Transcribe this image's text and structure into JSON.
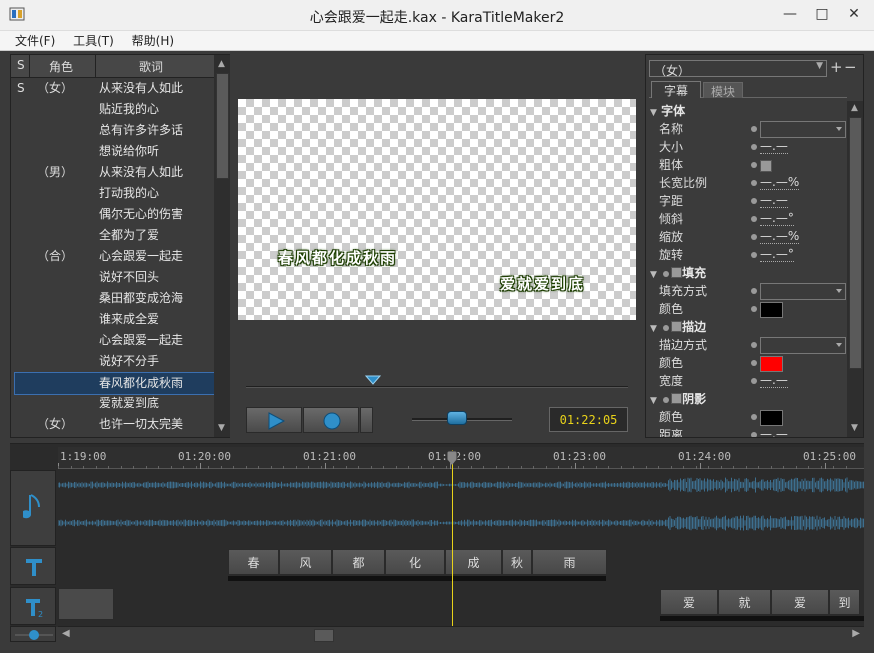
{
  "window": {
    "title": "心会跟爱一起走.kax - KaraTitleMaker2",
    "minimize": "—",
    "maximize": "□",
    "close": "✕"
  },
  "menu": [
    {
      "label": "文件(F)"
    },
    {
      "label": "工具(T)"
    },
    {
      "label": "帮助(H)"
    }
  ],
  "lyrics": {
    "headers": {
      "s": "S",
      "role": "角色",
      "text": "歌词"
    },
    "rows": [
      {
        "s": "S",
        "role": "（女）",
        "text": "从来没有人如此"
      },
      {
        "s": "",
        "role": "",
        "text": "贴近我的心"
      },
      {
        "s": "",
        "role": "",
        "text": "总有许多许多话"
      },
      {
        "s": "",
        "role": "",
        "text": "想说给你听"
      },
      {
        "s": "",
        "role": "（男）",
        "text": "从来没有人如此"
      },
      {
        "s": "",
        "role": "",
        "text": "打动我的心"
      },
      {
        "s": "",
        "role": "",
        "text": "偶尔无心的伤害"
      },
      {
        "s": "",
        "role": "",
        "text": "全都为了爱"
      },
      {
        "s": "",
        "role": "（合）",
        "text": "心会跟爱一起走"
      },
      {
        "s": "",
        "role": "",
        "text": "说好不回头"
      },
      {
        "s": "",
        "role": "",
        "text": "桑田都变成沧海"
      },
      {
        "s": "",
        "role": "",
        "text": "谁来成全爱"
      },
      {
        "s": "",
        "role": "",
        "text": "心会跟爱一起走"
      },
      {
        "s": "",
        "role": "",
        "text": "说好不分手"
      },
      {
        "s": "",
        "role": "",
        "text": "春风都化成秋雨"
      },
      {
        "s": "",
        "role": "",
        "text": "爱就爱到底"
      },
      {
        "s": "",
        "role": "（女）",
        "text": "也许一切太完美"
      }
    ],
    "selected_index": 14
  },
  "preview": {
    "line1": "春风都化成秋雨",
    "line2": "爱就爱到底"
  },
  "playback": {
    "time": "01:22:05",
    "progress": 0.32,
    "volume": 0.45
  },
  "props": {
    "role_select": "（女）",
    "tabs": [
      {
        "label": "字幕"
      },
      {
        "label": "模块"
      }
    ],
    "font_section": "字体",
    "font": [
      {
        "label": "名称",
        "type": "ddl",
        "value": ""
      },
      {
        "label": "大小",
        "type": "val",
        "value": "—.—"
      },
      {
        "label": "粗体",
        "type": "chk",
        "value": ""
      },
      {
        "label": "长宽比例",
        "type": "val",
        "value": "—.—%"
      },
      {
        "label": "字距",
        "type": "val",
        "value": "—.—"
      },
      {
        "label": "倾斜",
        "type": "val",
        "value": "—.—°"
      },
      {
        "label": "缩放",
        "type": "val",
        "value": "—.—%"
      },
      {
        "label": "旋转",
        "type": "val",
        "value": "—.—°"
      }
    ],
    "fill_section": "填充",
    "fill": [
      {
        "label": "填充方式",
        "type": "ddl",
        "value": ""
      },
      {
        "label": "颜色",
        "type": "color",
        "value": "#000000"
      }
    ],
    "stroke_section": "描边",
    "stroke": [
      {
        "label": "描边方式",
        "type": "ddl",
        "value": ""
      },
      {
        "label": "颜色",
        "type": "color",
        "value": "#ff0000"
      },
      {
        "label": "宽度",
        "type": "val",
        "value": "—.—"
      }
    ],
    "shadow_section": "阴影",
    "shadow": [
      {
        "label": "颜色",
        "type": "color",
        "value": "#000000"
      },
      {
        "label": "距离",
        "type": "val",
        "value": "—.—"
      }
    ]
  },
  "timeline": {
    "ticks": [
      "1:19:00",
      "01:20:00",
      "01:21:00",
      "01:22:00",
      "01:23:00",
      "01:24:00",
      "01:25:00"
    ],
    "track1_syllables": [
      {
        "text": "春"
      },
      {
        "text": "风"
      },
      {
        "text": "都"
      },
      {
        "text": "化"
      },
      {
        "text": "成"
      },
      {
        "text": "秋"
      },
      {
        "text": "雨"
      }
    ],
    "track2_syllables": [
      {
        "text": "爱"
      },
      {
        "text": "就"
      },
      {
        "text": "爱"
      },
      {
        "text": "到"
      }
    ]
  },
  "colors": {
    "accent": "#3b6fb0",
    "time_text": "#e8d21a",
    "playhead": "#e8d21a",
    "waveform": "#3d6f8f"
  }
}
